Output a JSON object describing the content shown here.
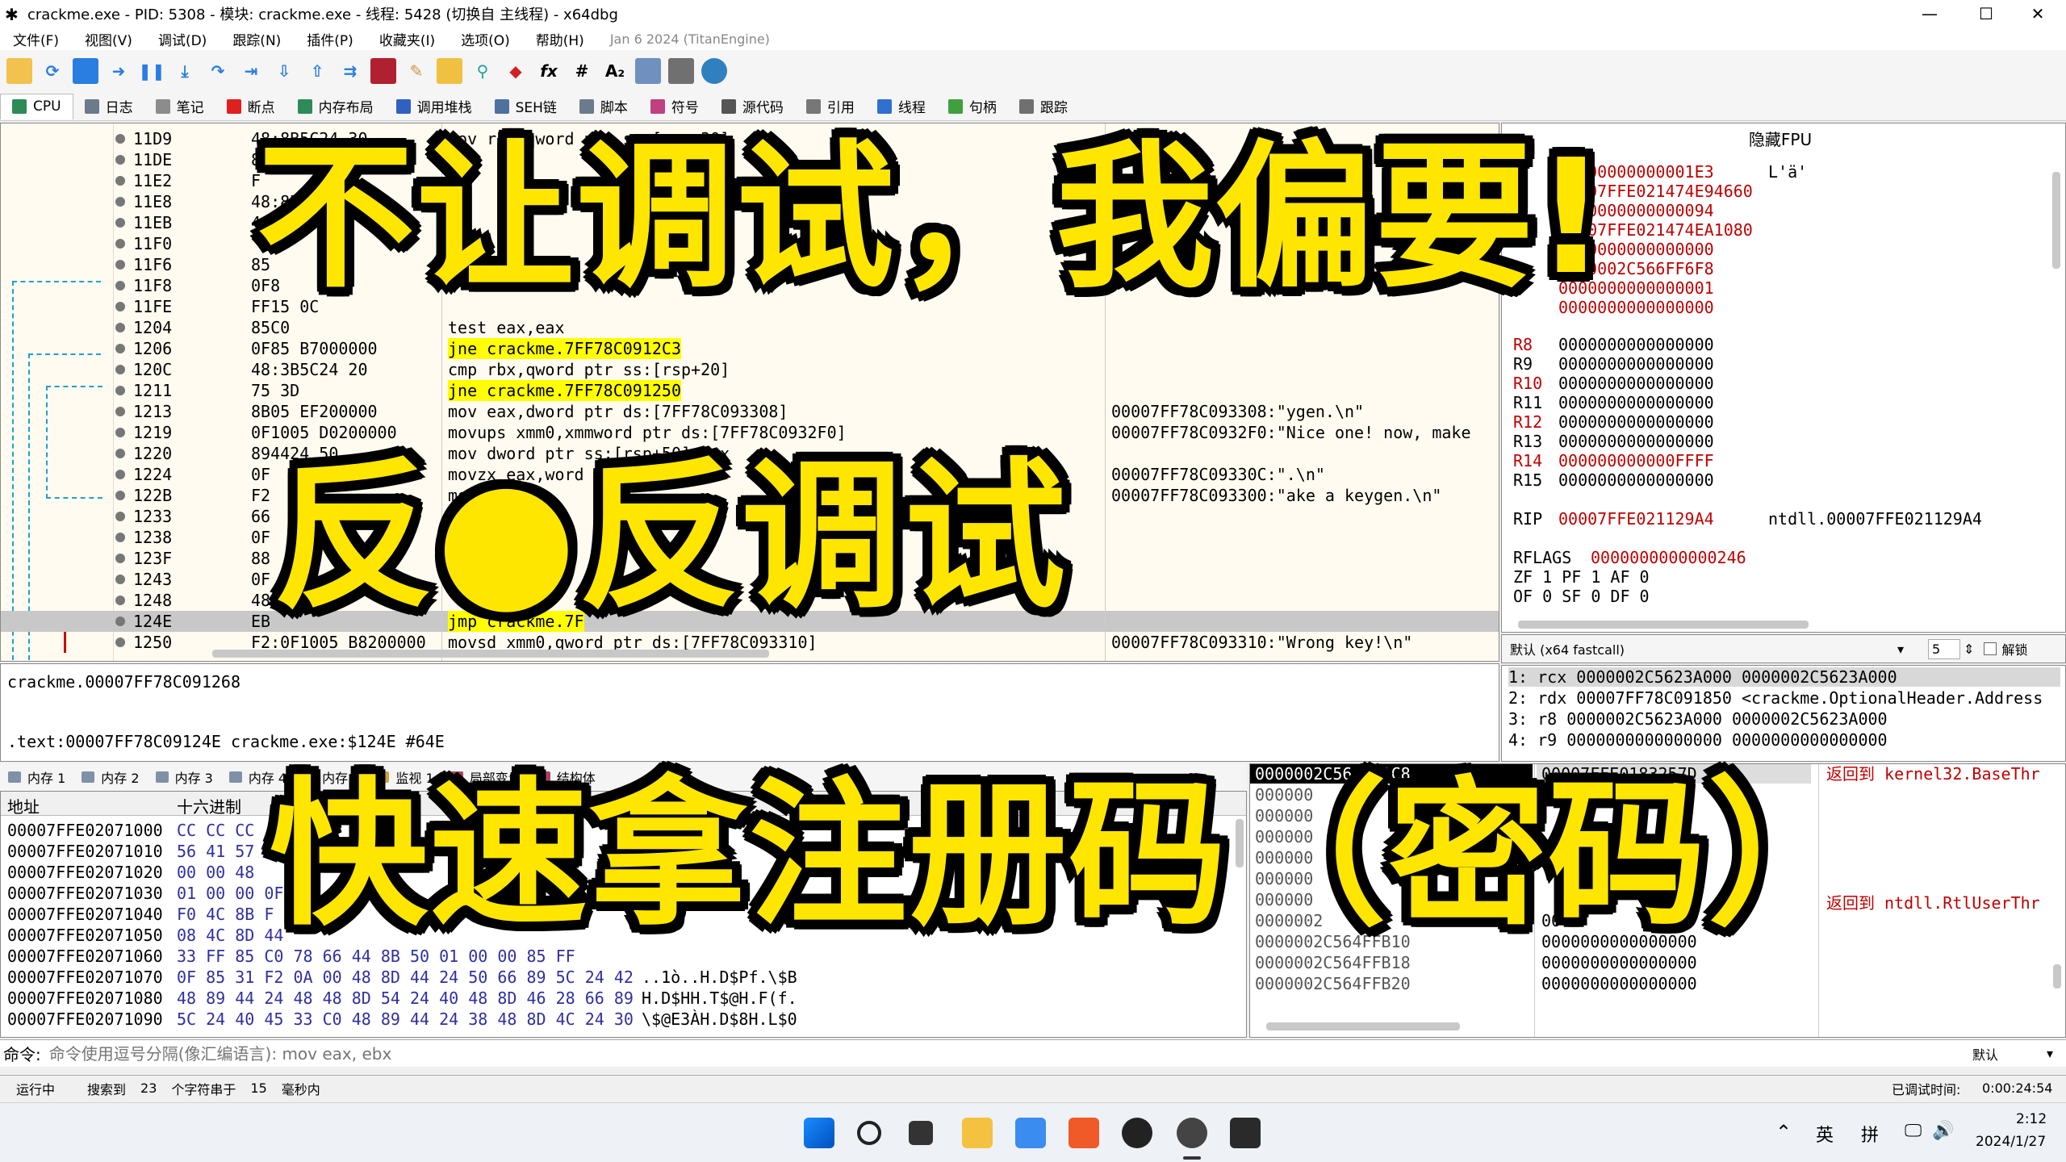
{
  "window": {
    "title": "crackme.exe - PID: 5308 - 模块: crackme.exe - 线程: 5428 (切换自 主线程) - x64dbg",
    "minimize": "—",
    "maximize": "☐",
    "close": "✕"
  },
  "menu": [
    "文件(F)",
    "视图(V)",
    "调试(D)",
    "跟踪(N)",
    "插件(P)",
    "收藏夹(I)",
    "选项(O)",
    "帮助(H)",
    "Jan 6 2024 (TitanEngine)"
  ],
  "toolbar": {
    "fx_label": "fx",
    "hash_label": "#",
    "az_label": "A₂"
  },
  "tabs": [
    {
      "label": "CPU",
      "color": "#2e8b57"
    },
    {
      "label": "日志",
      "color": "#6b7b8c"
    },
    {
      "label": "笔记",
      "color": "#8c8c8c"
    },
    {
      "label": "断点",
      "color": "#e02020"
    },
    {
      "label": "内存布局",
      "color": "#2e8b57"
    },
    {
      "label": "调用堆栈",
      "color": "#3060c0"
    },
    {
      "label": "SEH链",
      "color": "#5070a0"
    },
    {
      "label": "脚本",
      "color": "#6b7b8c"
    },
    {
      "label": "符号",
      "color": "#c04080"
    },
    {
      "label": "源代码",
      "color": "#555555"
    },
    {
      "label": "引用",
      "color": "#777777"
    },
    {
      "label": "线程",
      "color": "#3070d0"
    },
    {
      "label": "句柄",
      "color": "#40a040"
    },
    {
      "label": "跟踪",
      "color": "#707070"
    }
  ],
  "disasm": [
    {
      "addr": "11D9",
      "hex": "48:8B5C24 30",
      "ins": "mov rbx,qword ptr ss:[rsp+30]",
      "cmt": ""
    },
    {
      "addr": "11DE",
      "hex": "8",
      "ins": "",
      "cmt": ""
    },
    {
      "addr": "11E2",
      "hex": "F",
      "ins": "",
      "cmt": ""
    },
    {
      "addr": "11E8",
      "hex": "48:8B",
      "ins": "",
      "cmt": ""
    },
    {
      "addr": "11EB",
      "hex": "48:",
      "ins": "",
      "cmt": ""
    },
    {
      "addr": "11F0",
      "hex": "",
      "ins": "",
      "cmt": ""
    },
    {
      "addr": "11F6",
      "hex": "85",
      "ins": "",
      "cmt": ""
    },
    {
      "addr": "11F8",
      "hex": "0F8",
      "ins": "",
      "cmt": ""
    },
    {
      "addr": "11FE",
      "hex": "FF15 0C",
      "ins": "",
      "cmt": ""
    },
    {
      "addr": "1204",
      "hex": "85C0",
      "ins": "test eax,eax",
      "cmt": ""
    },
    {
      "addr": "1206",
      "hex": "0F85 B7000000",
      "ins": "jne crackme.7FF78C0912C3",
      "cmt": ""
    },
    {
      "addr": "120C",
      "hex": "48:3B5C24 20",
      "ins": "cmp rbx,qword ptr ss:[rsp+20]",
      "cmt": ""
    },
    {
      "addr": "1211",
      "hex": "75 3D",
      "ins": "jne crackme.7FF78C091250",
      "cmt": ""
    },
    {
      "addr": "1213",
      "hex": "8B05 EF200000",
      "ins": "mov eax,dword ptr ds:[7FF78C093308]",
      "cmt": "00007FF78C093308:\"ygen.\\n\""
    },
    {
      "addr": "1219",
      "hex": "0F1005 D0200000",
      "ins": "movups xmm0,xmmword ptr ds:[7FF78C0932F0]",
      "cmt": "00007FF78C0932F0:\"Nice one! now, make"
    },
    {
      "addr": "1220",
      "hex": "894424 50",
      "ins": "mov dword ptr ss:[rsp+50],eax",
      "cmt": ""
    },
    {
      "addr": "1224",
      "hex": "0F",
      "ins": "movzx eax,word",
      "cmt": "00007FF78C09330C:\".\\n\""
    },
    {
      "addr": "122B",
      "hex": "F2",
      "ins": "mo",
      "cmt": "00007FF78C093300:\"ake a keygen.\\n\""
    },
    {
      "addr": "1233",
      "hex": "66",
      "ins": "",
      "cmt": ""
    },
    {
      "addr": "1238",
      "hex": "0F",
      "ins": "",
      "cmt": ""
    },
    {
      "addr": "123F",
      "hex": "88",
      "ins": "",
      "cmt": ""
    },
    {
      "addr": "1243",
      "hex": "0F",
      "ins": "",
      "cmt": ""
    },
    {
      "addr": "1248",
      "hex": "48",
      "ins": "",
      "cmt": ""
    },
    {
      "addr": "124E",
      "hex": "EB",
      "ins": "jmp crackme.7F",
      "cmt": ""
    },
    {
      "addr": "1250",
      "hex": "F2:0F1005 B8200000",
      "ins": "movsd xmm0,qword ptr ds:[7FF78C093310]",
      "cmt": "00007FF78C093310:\"Wrong key!\\n\""
    }
  ],
  "registers": {
    "header": "隐藏FPU",
    "top": [
      {
        "val": "00000000000001E3",
        "extra": "L'ä'"
      },
      {
        "val": "00007FFE021474E94660",
        "extra": ""
      },
      {
        "val": "0000000000000094",
        "extra": ""
      },
      {
        "val": "00007FFE021474EA1080",
        "extra": ""
      },
      {
        "val": "0000000000000000",
        "extra": ""
      },
      {
        "val": "0000002C566FF6F8",
        "extra": ""
      },
      {
        "val": "0000000000000001",
        "extra": ""
      },
      {
        "val": "0000000000000000",
        "extra": ""
      }
    ],
    "ext": [
      {
        "name": "R8",
        "val": "0000000000000000"
      },
      {
        "name": "R9",
        "val": "0000000000000000"
      },
      {
        "name": "R10",
        "val": "0000000000000000"
      },
      {
        "name": "R11",
        "val": "0000000000000000"
      },
      {
        "name": "R12",
        "val": "0000000000000000"
      },
      {
        "name": "R13",
        "val": "0000000000000000"
      },
      {
        "name": "R14",
        "val": "000000000000FFFF"
      },
      {
        "name": "R15",
        "val": "0000000000000000"
      }
    ],
    "rip_name": "RIP",
    "rip_val": "00007FFE021129A4",
    "rip_sym": "ntdll.00007FFE021129A4",
    "rflags_name": "RFLAGS",
    "rflags_val": "0000000000000246",
    "flags1": "ZF 1  PF 1  AF 0",
    "flags2": "OF 0  SF 0  DF 0"
  },
  "callconv": {
    "label": "默认 (x64 fastcall)",
    "count": "5",
    "unlock": "解锁"
  },
  "stackargs": [
    "1: rcx 0000002C5623A000 0000002C5623A000",
    "2: rdx 00007FF78C091850 <crackme.OptionalHeader.Address",
    "3: r8 0000002C5623A000 0000002C5623A000",
    "4: r9 0000000000000000 0000000000000000"
  ],
  "info": {
    "line1": "crackme.00007FF78C091268",
    "line2": ".text:00007FF78C09124E crackme.exe:$124E #64E"
  },
  "memtabs": [
    "内存 1",
    "内存 2",
    "内存 3",
    "内存 4",
    "内存 5",
    "监视 1",
    "局部变量",
    "结构体"
  ],
  "dump": {
    "col_addr": "地址",
    "col_hex": "十六进制",
    "rows": [
      {
        "addr": "00007FFE02071000",
        "hex": "CC CC CC",
        "asc": ""
      },
      {
        "addr": "00007FFE02071010",
        "hex": "56 41 57",
        "asc": ""
      },
      {
        "addr": "00007FFE02071020",
        "hex": "00 00 48",
        "asc": ""
      },
      {
        "addr": "00007FFE02071030",
        "hex": "01 00 00 0F",
        "asc": ""
      },
      {
        "addr": "00007FFE02071040",
        "hex": "F0 4C 8B F",
        "asc": ""
      },
      {
        "addr": "00007FFE02071050",
        "hex": "08 4C 8D 44",
        "asc": ""
      },
      {
        "addr": "00007FFE02071060",
        "hex": "33 FF 85 C0 78 66 44 8B 50 01 00 00 85 FF",
        "asc": ""
      },
      {
        "addr": "00007FFE02071070",
        "hex": "0F 85 31 F2 0A 00 48 8D 44 24 50 66 89 5C 24 42",
        "asc": "..1ò..H.D$Pf.\\$B"
      },
      {
        "addr": "00007FFE02071080",
        "hex": "48 89 44 24 48 48 8D 54 24 40 48 8D 46 28 66 89",
        "asc": "H.D$HH.T$@H.F(f."
      },
      {
        "addr": "00007FFE02071090",
        "hex": "5C 24 40 45 33 C0 48 89 44 24 38 48 8D 4C 24 30",
        "asc": "\\$@E3ÀH.D$8H.L$0"
      }
    ]
  },
  "stack": {
    "top_addr": "0000002C564FFAC8",
    "top_val": "00007FFE0183257D",
    "top_cmt": "返回到 kernel32.BaseThr",
    "mid_cmt": "返回到 ntdll.RtlUserThr",
    "rows": [
      {
        "addr": "000000",
        "val": ""
      },
      {
        "addr": "000000",
        "val": ""
      },
      {
        "addr": "000000",
        "val": ""
      },
      {
        "addr": "000000",
        "val": ""
      },
      {
        "addr": "000000",
        "val": ""
      },
      {
        "addr": "000000",
        "val": ""
      },
      {
        "addr": "0000002",
        "val": "00"
      },
      {
        "addr": "0000002C564FFB10",
        "val": "0000000000000000"
      },
      {
        "addr": "0000002C564FFB18",
        "val": "0000000000000000"
      },
      {
        "addr": "0000002C564FFB20",
        "val": "0000000000000000"
      }
    ]
  },
  "cmd": {
    "label": "命令:",
    "placeholder": "命令使用逗号分隔(像汇编语言): mov eax, ebx",
    "mode": "默认"
  },
  "status": {
    "state": "运行中",
    "search_label": "搜索到",
    "search_count": "23",
    "search_unit": "个字符串于",
    "search_ms": "15",
    "ms_unit": "毫秒内",
    "elapsed_label": "已调试时间:",
    "elapsed": "0:00:24:54"
  },
  "taskbar": {
    "lang1": "英",
    "lang2": "拼",
    "time": "2:12",
    "date": "2024/1/27"
  },
  "overlay": {
    "line1": "不让调试，我偏要!",
    "line2": "反●反调试",
    "line3": "快速拿注册码（密码）"
  }
}
